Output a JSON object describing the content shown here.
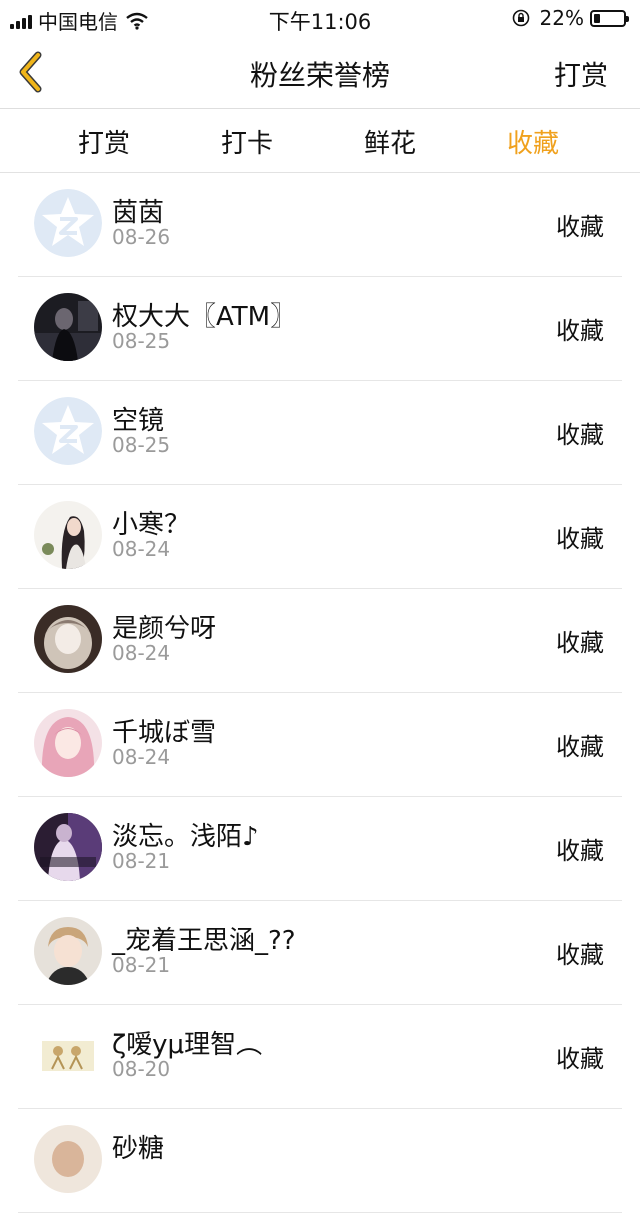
{
  "status_bar": {
    "carrier": "中国电信",
    "time": "下午11:06",
    "battery": "22%",
    "battery_level": 0.22
  },
  "nav": {
    "title": "粉丝荣誉榜",
    "action": "打赏",
    "back_icon": "chevron-left-icon",
    "back_color": "#f0b51a"
  },
  "tabs": [
    {
      "label": "打赏"
    },
    {
      "label": "打卡"
    },
    {
      "label": "鲜花"
    },
    {
      "label": "收藏",
      "active": true
    }
  ],
  "accent_color": "#f0a11d",
  "fans": [
    {
      "name": "茵茵",
      "date": "08-26",
      "kind": "收藏",
      "avatar": "default-avatar-icon"
    },
    {
      "name": "权大大〖ATM〗",
      "date": "08-25",
      "kind": "收藏",
      "avatar": "photo-avatar"
    },
    {
      "name": "空镜",
      "date": "08-25",
      "kind": "收藏",
      "avatar": "default-avatar-icon"
    },
    {
      "name": "小寒？",
      "date": "08-24",
      "kind": "收藏",
      "avatar": "photo-avatar"
    },
    {
      "name": "是颜兮呀",
      "date": "08-24",
      "kind": "收藏",
      "avatar": "photo-avatar"
    },
    {
      "name": "千城ぼ雪",
      "date": "08-24",
      "kind": "收藏",
      "avatar": "photo-avatar"
    },
    {
      "name": "淡忘。浅陌♪",
      "date": "08-21",
      "kind": "收藏",
      "avatar": "photo-avatar"
    },
    {
      "name": "_宠着王思涵_??",
      "date": "08-21",
      "kind": "收藏",
      "avatar": "photo-avatar"
    },
    {
      "name": "ζ嗳yμ理智︵",
      "date": "08-20",
      "kind": "收藏",
      "avatar": "photo-avatar"
    },
    {
      "name": "砂糖",
      "date": "",
      "kind": "",
      "avatar": "photo-avatar"
    }
  ]
}
